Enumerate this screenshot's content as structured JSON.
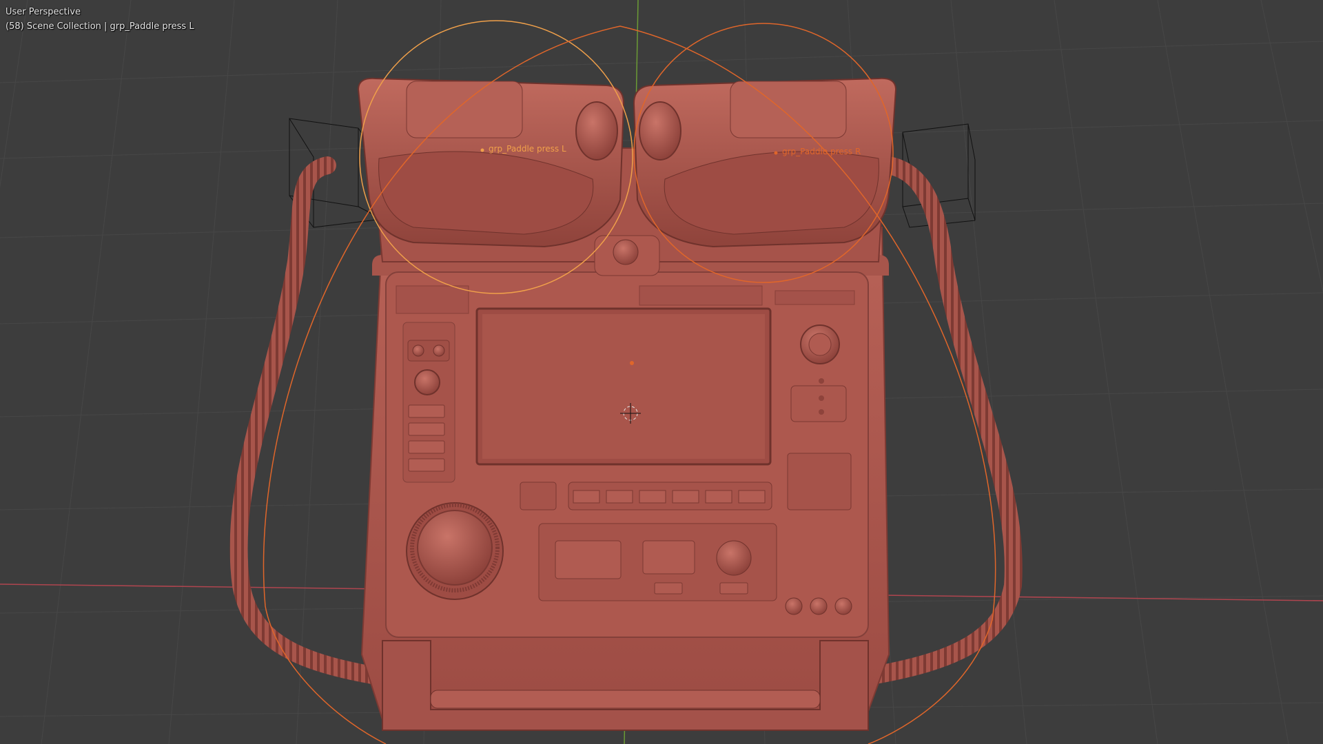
{
  "viewport": {
    "view_mode": "User Perspective",
    "scene_info": "(58) Scene Collection | grp_Paddle press L"
  },
  "objects": {
    "left_label": "grp_Paddle press L",
    "right_label": "grp_Paddle press R"
  },
  "colors": {
    "background": "#3d3d3d",
    "grid": "#474747",
    "x_axis": "#b0454f",
    "y_axis": "#6b9b35",
    "model": "#b35a50",
    "selection_active": "#f0a04a",
    "selection": "#e0662a"
  }
}
